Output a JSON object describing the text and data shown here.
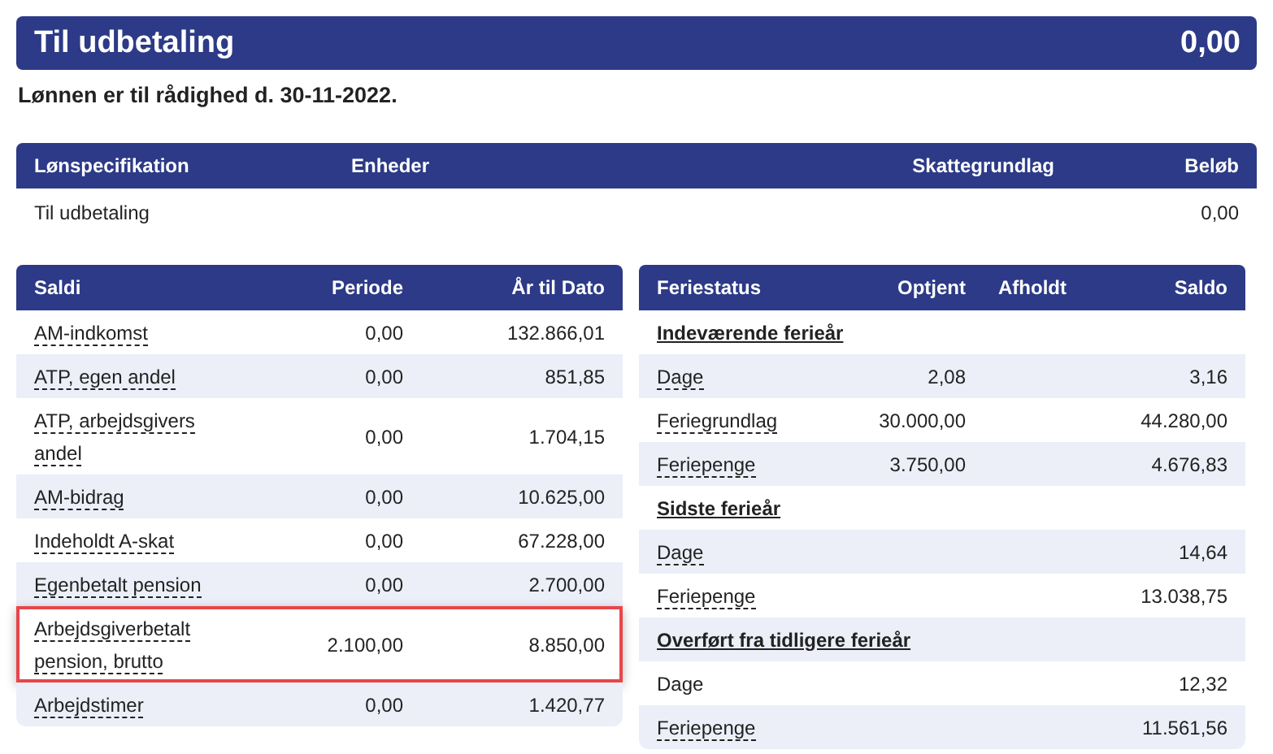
{
  "payout": {
    "title": "Til udbetaling",
    "amount": "0,00"
  },
  "availability": "Lønnen er til rådighed d. 30-11-2022.",
  "spec": {
    "columns": [
      "Lønspecifikation",
      "Enheder",
      "Skattegrundlag",
      "Beløb"
    ],
    "rows": [
      {
        "label": "Til udbetaling",
        "units": "",
        "tax_base": "",
        "amount": "0,00"
      }
    ]
  },
  "balances": {
    "columns": [
      "Saldi",
      "Periode",
      "År til Dato"
    ],
    "rows": [
      {
        "label": "AM-indkomst",
        "period": "0,00",
        "ytd": "132.866,01",
        "highlighted": false
      },
      {
        "label": "ATP, egen andel",
        "period": "0,00",
        "ytd": "851,85",
        "highlighted": false
      },
      {
        "label": "ATP, arbejdsgivers andel",
        "period": "0,00",
        "ytd": "1.704,15",
        "highlighted": false
      },
      {
        "label": "AM-bidrag",
        "period": "0,00",
        "ytd": "10.625,00",
        "highlighted": false
      },
      {
        "label": "Indeholdt A-skat",
        "period": "0,00",
        "ytd": "67.228,00",
        "highlighted": false
      },
      {
        "label": "Egenbetalt pension",
        "period": "0,00",
        "ytd": "2.700,00",
        "highlighted": false
      },
      {
        "label": "Arbejdsgiverbetalt pension, brutto",
        "period": "2.100,00",
        "ytd": "8.850,00",
        "highlighted": true
      },
      {
        "label": "Arbejdstimer",
        "period": "0,00",
        "ytd": "1.420,77",
        "highlighted": false
      }
    ]
  },
  "vacation": {
    "columns": [
      "Feriestatus",
      "Optjent",
      "Afholdt",
      "Saldo"
    ],
    "rows": [
      {
        "kind": "section",
        "label": "Indeværende ferieår"
      },
      {
        "kind": "item",
        "label": "Dage",
        "earned": "2,08",
        "taken": "",
        "balance": "3,16",
        "tooltip": true
      },
      {
        "kind": "item",
        "label": "Feriegrundlag",
        "earned": "30.000,00",
        "taken": "",
        "balance": "44.280,00",
        "tooltip": true
      },
      {
        "kind": "item",
        "label": "Feriepenge",
        "earned": "3.750,00",
        "taken": "",
        "balance": "4.676,83",
        "tooltip": true
      },
      {
        "kind": "section",
        "label": "Sidste ferieår"
      },
      {
        "kind": "item",
        "label": "Dage",
        "earned": "",
        "taken": "",
        "balance": "14,64",
        "tooltip": true
      },
      {
        "kind": "item",
        "label": "Feriepenge",
        "earned": "",
        "taken": "",
        "balance": "13.038,75",
        "tooltip": true
      },
      {
        "kind": "section",
        "label": "Overført fra tidligere ferieår"
      },
      {
        "kind": "item",
        "label": "Dage",
        "earned": "",
        "taken": "",
        "balance": "12,32",
        "tooltip": false
      },
      {
        "kind": "item",
        "label": "Feriepenge",
        "earned": "",
        "taken": "",
        "balance": "11.561,56",
        "tooltip": true
      }
    ]
  }
}
